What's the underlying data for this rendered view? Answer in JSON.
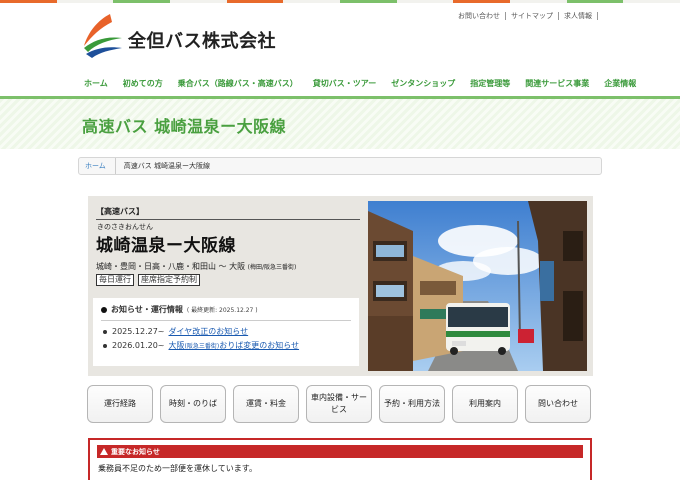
{
  "brand": {
    "name": "全但バス株式会社",
    "stripe_colors": [
      "#e86a2b",
      "#f2f2ee",
      "#7cc06a",
      "#f2f2ee",
      "#e86a2b",
      "#f2f2ee",
      "#7cc06a",
      "#f2f2ee",
      "#e86a2b",
      "#f2f2ee",
      "#7cc06a",
      "#f2f2ee"
    ],
    "accent_green": "#4aa040",
    "alert_red": "#c62828"
  },
  "utility_nav": [
    "お問い合わせ",
    "サイトマップ",
    "求人情報"
  ],
  "global_nav": [
    "ホーム",
    "初めての方",
    "乗合バス（路線バス・高速バス）",
    "貸切バス・ツアー",
    "ゼンタンショップ",
    "指定管理等",
    "関連サービス事業",
    "企業情報"
  ],
  "page_title": "高速バス 城崎温泉ー大阪線",
  "breadcrumb": {
    "home": "ホーム",
    "current": "高速バス 城崎温泉ー大阪線"
  },
  "route": {
    "tag": "【高速バス】",
    "ruby": "きのさきおんせん",
    "name": "城崎温泉ー大阪線",
    "stops": "城崎・豊岡・日高・八鹿・和田山 〜 大阪",
    "stops_note": "(梅田/阪急三番街)",
    "badges": [
      "毎日運行",
      "座席指定予約制"
    ]
  },
  "notice": {
    "heading": "お知らせ・運行情報",
    "updated": "( 最終更新: 2025.12.27 )",
    "items": [
      {
        "date": "2025.12.27~",
        "link": "ダイヤ改正のお知らせ",
        "link_note": "",
        "link_tail": ""
      },
      {
        "date": "2026.01.20~",
        "link": "大阪",
        "link_note": "(阪急三番街)",
        "link_tail": "おりば変更のお知らせ"
      }
    ]
  },
  "photo_icon": "city-bus-street-photo",
  "buttons": [
    "運行経路",
    "時刻・のりば",
    "運賃・料金",
    "車内設備・サービス",
    "予約・利用方法",
    "利用案内",
    "問い合わせ"
  ],
  "alert": {
    "icon": "warning-icon",
    "heading": "重要なお知らせ",
    "body": "乗務員不足のため一部便を運休しています。"
  }
}
